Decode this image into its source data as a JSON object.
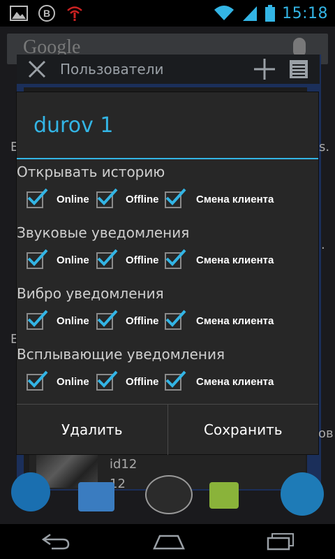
{
  "status_bar": {
    "time": "15:18",
    "icons": [
      "gallery-icon",
      "vk-icon",
      "no-signal-warning-icon",
      "wifi-icon",
      "cell-signal-icon",
      "battery-icon"
    ]
  },
  "background": {
    "search_text": "Google",
    "app_title": "Пользователи",
    "partial_left_1": "E",
    "partial_right_1": "s.",
    "partial_right_2": ".",
    "partial_left_2": "E",
    "partial_right_3": "ов",
    "list_item": {
      "id": "id12",
      "value": "12"
    }
  },
  "dialog": {
    "title": "durov 1",
    "sections": [
      {
        "label": "Открывать историю",
        "options": [
          {
            "label": "Online",
            "checked": true
          },
          {
            "label": "Offline",
            "checked": true
          },
          {
            "label": "Смена клиента",
            "checked": true
          }
        ]
      },
      {
        "label": "Звуковые уведомления",
        "options": [
          {
            "label": "Online",
            "checked": true
          },
          {
            "label": "Offline",
            "checked": true
          },
          {
            "label": "Смена клиента",
            "checked": true
          }
        ]
      },
      {
        "label": "Вибро уведомления",
        "options": [
          {
            "label": "Online",
            "checked": true
          },
          {
            "label": "Offline",
            "checked": true
          },
          {
            "label": "Смена клиента",
            "checked": true
          }
        ]
      },
      {
        "label": "Всплывающие уведомления",
        "options": [
          {
            "label": "Online",
            "checked": true
          },
          {
            "label": "Offline",
            "checked": true
          },
          {
            "label": "Смена клиента",
            "checked": true
          }
        ]
      }
    ],
    "buttons": {
      "delete": "Удалить",
      "save": "Сохранить"
    }
  },
  "colors": {
    "accent": "#33b5e5",
    "dialog_bg": "#272727",
    "text": "#ffffff"
  }
}
